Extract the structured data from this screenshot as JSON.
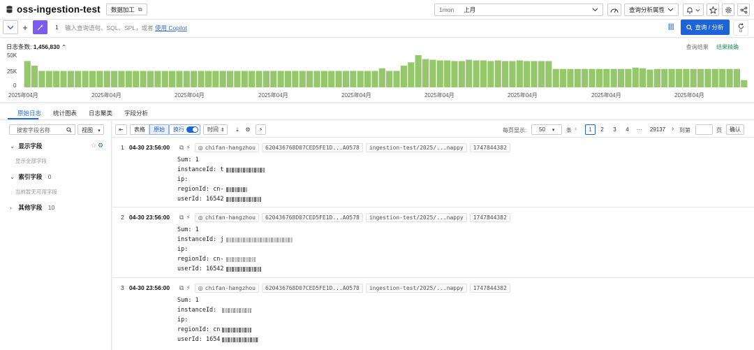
{
  "header": {
    "title": "oss-ingestion-test",
    "process_label": "数据加工",
    "time_range_short": "1mon",
    "time_range_label": "上月",
    "query_attr_label": "查询分析属性"
  },
  "search": {
    "line_number": "1",
    "placeholder": "输入查询语句、SQL、SPL，或者",
    "copilot_link": "使用 Copilot",
    "query_button": "查询 / 分析"
  },
  "histogram": {
    "count_label": "日志条数:",
    "count_value": "1,456,830",
    "result_link": "查询结果",
    "accurate_label": "结果精确",
    "accent_color": "#95c86a",
    "y_ticks": [
      "50K",
      "25K",
      "0"
    ],
    "x_ticks": [
      "2025年04月",
      "2025年04月",
      "2025年04月",
      "2025年04月",
      "2025年04月",
      "2025年04月",
      "2025年04月",
      "2025年04月",
      "2025年04月"
    ]
  },
  "chart_data": {
    "type": "bar",
    "ylim": [
      0,
      50000
    ],
    "values": [
      40000,
      33000,
      25000,
      25000,
      25000,
      25000,
      25000,
      25000,
      25000,
      25000,
      25000,
      25000,
      25000,
      25000,
      25000,
      25000,
      25000,
      25000,
      25000,
      25000,
      25000,
      25000,
      25000,
      25000,
      25000,
      25000,
      25000,
      25000,
      25000,
      25000,
      25000,
      25000,
      25000,
      25000,
      25000,
      25000,
      25000,
      25000,
      25000,
      25000,
      25000,
      25000,
      25000,
      25000,
      25000,
      25000,
      25000,
      25000,
      25000,
      29000,
      25000,
      25000,
      33000,
      38000,
      49000,
      43000,
      42000,
      41000,
      41000,
      40000,
      40000,
      42000,
      41000,
      41000,
      40000,
      41000,
      40000,
      40000,
      41000,
      40000,
      40000,
      40000,
      40000,
      28000,
      28000,
      28000,
      28000,
      28000,
      28000,
      28000,
      28000,
      28000,
      28000,
      28000,
      30000,
      29000,
      27000,
      28000,
      28000,
      28000,
      28000,
      28000,
      28000,
      28000,
      28000,
      28000,
      28000,
      28000,
      28000,
      11000
    ]
  },
  "tabs": [
    "原始日志",
    "统计图表",
    "日志聚类",
    "字段分析"
  ],
  "field_panel": {
    "search_placeholder": "搜索字段名称",
    "view_label": "视图",
    "show_fields": "显示字段",
    "show_all": "显示全部字段",
    "index_fields": "索引字段",
    "index_count": "0",
    "no_index_note": "当前暂无可用字段",
    "other_fields": "其他字段",
    "other_count": "10"
  },
  "toolbar": {
    "table_label": "表格",
    "raw_label": "原始",
    "wrap_label": "换行",
    "time_label": "时间",
    "per_page_label": "每页显示:",
    "per_page_value": "50",
    "items_label": "条",
    "pages": [
      "1",
      "2",
      "3",
      "4"
    ],
    "ellipsis": "···",
    "last_page": "29137",
    "goto_label": "到第",
    "page_unit": "页",
    "confirm_label": "确认"
  },
  "logs": [
    {
      "index": "1",
      "time": "04-30 23:56:00",
      "tags": [
        "chifan-hangzhou",
        "620436768D07CED5FE1D...A0578",
        "ingestion-test/2025/...nappy",
        "1747844382"
      ],
      "fields": [
        {
          "key": "Sum:",
          "value": "1"
        },
        {
          "key": "instanceId:",
          "value": "t"
        },
        {
          "key": "ip:",
          "value": ""
        },
        {
          "key": "regionId:",
          "value": "cn-"
        },
        {
          "key": "userId:",
          "value": "16542"
        }
      ]
    },
    {
      "index": "2",
      "time": "04-30 23:56:00",
      "tags": [
        "chifan-hangzhou",
        "620436768D07CED5FE1D...A0578",
        "ingestion-test/2025/...nappy",
        "1747844382"
      ],
      "fields": [
        {
          "key": "Sum:",
          "value": "1"
        },
        {
          "key": "instanceId:",
          "value": "j"
        },
        {
          "key": "ip:",
          "value": ""
        },
        {
          "key": "regionId:",
          "value": "cn-"
        },
        {
          "key": "userId:",
          "value": "16542"
        }
      ]
    },
    {
      "index": "3",
      "time": "04-30 23:56:00",
      "tags": [
        "chifan-hangzhou",
        "620436768D07CED5FE1D...A0578",
        "ingestion-test/2025/...nappy",
        "1747844382"
      ],
      "fields": [
        {
          "key": "Sum:",
          "value": "1"
        },
        {
          "key": "instanceId:",
          "value": ""
        },
        {
          "key": "ip:",
          "value": ""
        },
        {
          "key": "regionId:",
          "value": "cn"
        },
        {
          "key": "userId:",
          "value": "1654"
        }
      ]
    }
  ]
}
